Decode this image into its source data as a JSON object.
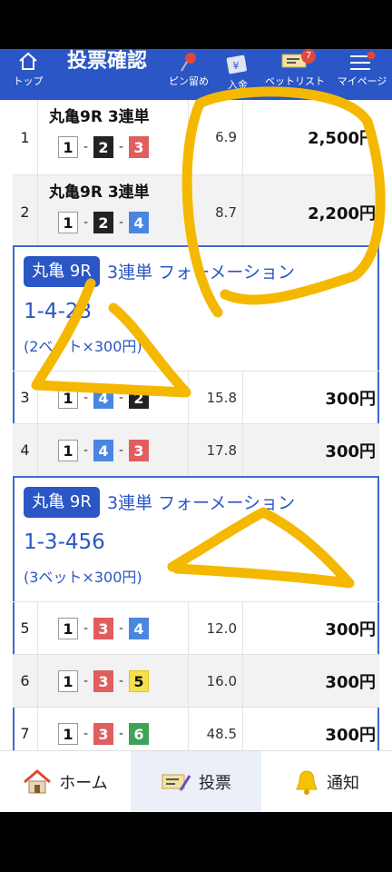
{
  "header": {
    "top_label": "トップ",
    "title": "投票確認",
    "pin_label": "ピン留め",
    "deposit_label": "入金",
    "betlist_label": "ベットリスト",
    "betlist_badge": "7",
    "mypage_label": "マイページ"
  },
  "single_bets": [
    {
      "no": "1",
      "race": "丸亀9R 3連単",
      "boats": [
        "1",
        "2",
        "3"
      ],
      "odds": "6.9",
      "amount": "2,500円"
    },
    {
      "no": "2",
      "race": "丸亀9R 3連単",
      "boats": [
        "1",
        "2",
        "4"
      ],
      "odds": "8.7",
      "amount": "2,200円"
    }
  ],
  "formations": [
    {
      "race_tag": "丸亀 9R",
      "bet_type": "3連単 フォーメーション",
      "combination": "1-4-23",
      "bet_count": "(2ベット×300円)",
      "rows": [
        {
          "no": "3",
          "boats": [
            "1",
            "4",
            "2"
          ],
          "odds": "15.8",
          "amount": "300円"
        },
        {
          "no": "4",
          "boats": [
            "1",
            "4",
            "3"
          ],
          "odds": "17.8",
          "amount": "300円"
        }
      ]
    },
    {
      "race_tag": "丸亀 9R",
      "bet_type": "3連単 フォーメーション",
      "combination": "1-3-456",
      "bet_count": "(3ベット×300円)",
      "rows": [
        {
          "no": "5",
          "boats": [
            "1",
            "3",
            "4"
          ],
          "odds": "12.0",
          "amount": "300円"
        },
        {
          "no": "6",
          "boats": [
            "1",
            "3",
            "5"
          ],
          "odds": "16.0",
          "amount": "300円"
        },
        {
          "no": "7",
          "boats": [
            "1",
            "3",
            "6"
          ],
          "odds": "48.5",
          "amount": "300円"
        }
      ]
    }
  ],
  "bottom_nav": {
    "home_label": "ホーム",
    "vote_label": "投票",
    "notify_label": "通知"
  },
  "colors": {
    "brand_blue": "#2a56c6",
    "annotation_yellow": "#f5b800"
  }
}
